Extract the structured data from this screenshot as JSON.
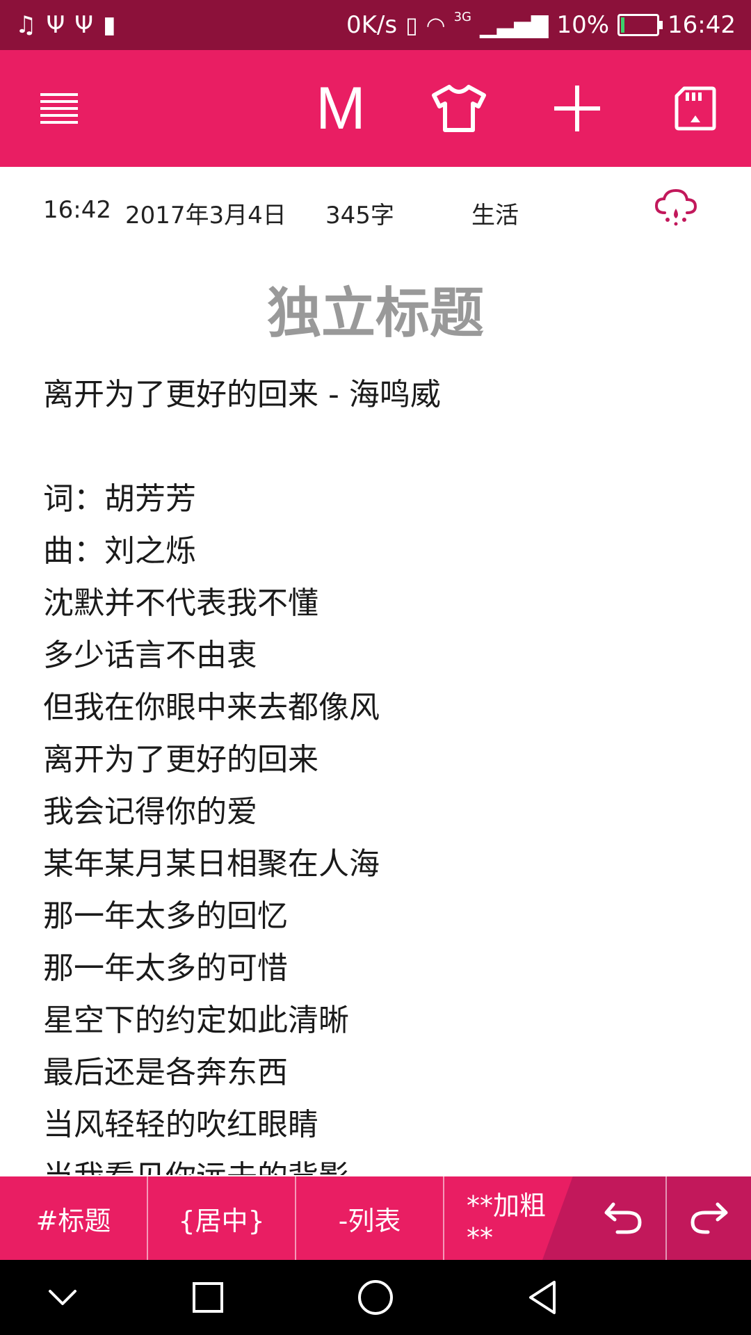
{
  "status_bar": {
    "left_icons": [
      "music-note-icon",
      "usb-icon",
      "usb-icon",
      "battery-alert-icon"
    ],
    "net_speed": "0K/s",
    "network": "3G",
    "battery": "10%",
    "time": "16:42",
    "battery_level": 0.1
  },
  "toolbar": {
    "m_label": "M"
  },
  "meta": {
    "time": "16:42",
    "date": "2017年3月4日",
    "word_count": "345字",
    "category": "生活"
  },
  "document": {
    "title": "独立标题",
    "lines": [
      "离开为了更好的回来 - 海鸣威",
      "",
      "词：胡芳芳",
      "曲：刘之烁",
      "沈默并不代表我不懂",
      "多少话言不由衷",
      "但我在你眼中来去都像风",
      "离开为了更好的回来",
      "我会记得你的爱",
      "某年某月某日相聚在人海",
      "那一年太多的回忆",
      "那一年太多的可惜",
      "星空下的约定如此清晰",
      "最后还是各奔东西",
      "当风轻轻的吹红眼睛",
      "当我看见你远去的背影"
    ]
  },
  "format_bar": {
    "heading": "#标题",
    "center": "{居中}",
    "list": "-列表",
    "bold": "**加粗**"
  },
  "colors": {
    "accent": "#e91e63",
    "status_bar": "#8c113a",
    "title_gray": "#999999"
  }
}
